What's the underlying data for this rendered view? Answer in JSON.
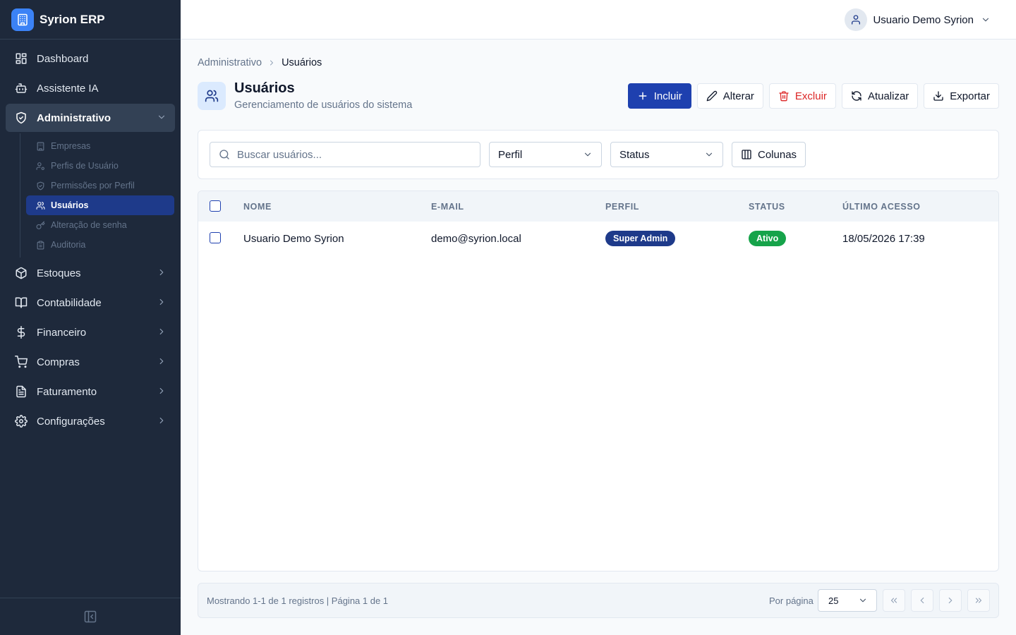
{
  "brand": {
    "name": "Syrion ERP",
    "logo_icon": "building-icon"
  },
  "sidebar": {
    "items": [
      {
        "label": "Dashboard",
        "icon": "dashboard-icon"
      },
      {
        "label": "Assistente IA",
        "icon": "bot-icon"
      },
      {
        "label": "Administrativo",
        "icon": "shield-icon",
        "expanded": true,
        "children": [
          {
            "label": "Empresas",
            "icon": "building-icon"
          },
          {
            "label": "Perfis de Usuário",
            "icon": "user-cog-icon"
          },
          {
            "label": "Permissões por Perfil",
            "icon": "shield-check-icon"
          },
          {
            "label": "Usuários",
            "icon": "users-icon",
            "active": true
          },
          {
            "label": "Alteração de senha",
            "icon": "key-icon"
          },
          {
            "label": "Auditoria",
            "icon": "clipboard-icon"
          }
        ]
      },
      {
        "label": "Estoques",
        "icon": "package-icon"
      },
      {
        "label": "Contabilidade",
        "icon": "book-icon"
      },
      {
        "label": "Financeiro",
        "icon": "dollar-icon"
      },
      {
        "label": "Compras",
        "icon": "cart-icon"
      },
      {
        "label": "Faturamento",
        "icon": "file-text-icon"
      },
      {
        "label": "Configurações",
        "icon": "gear-icon"
      }
    ]
  },
  "topbar": {
    "user_name": "Usuario Demo Syrion"
  },
  "breadcrumb": {
    "parent": "Administrativo",
    "current": "Usuários"
  },
  "page": {
    "title": "Usuários",
    "subtitle": "Gerenciamento de usuários do sistema"
  },
  "actions": {
    "add": "Incluir",
    "edit": "Alterar",
    "delete": "Excluir",
    "refresh": "Atualizar",
    "export": "Exportar"
  },
  "filters": {
    "search_placeholder": "Buscar usuários...",
    "profile_select": "Perfil",
    "status_select": "Status",
    "columns_button": "Colunas"
  },
  "table": {
    "columns": [
      "NOME",
      "E-MAIL",
      "PERFIL",
      "STATUS",
      "ÚLTIMO ACESSO"
    ],
    "rows": [
      {
        "name": "Usuario Demo Syrion",
        "email": "demo@syrion.local",
        "profile": "Super Admin",
        "status": "Ativo",
        "last_access": "18/05/2026 17:39"
      }
    ]
  },
  "pagination": {
    "info": "Mostrando 1-1 de 1 registros | Página 1 de 1",
    "per_page_label": "Por página",
    "per_page_value": "25"
  },
  "colors": {
    "sidebar_bg": "#1e293b",
    "primary": "#1e40af",
    "danger": "#dc2626",
    "success": "#16a34a",
    "badge_profile": "#1e3a8a"
  }
}
